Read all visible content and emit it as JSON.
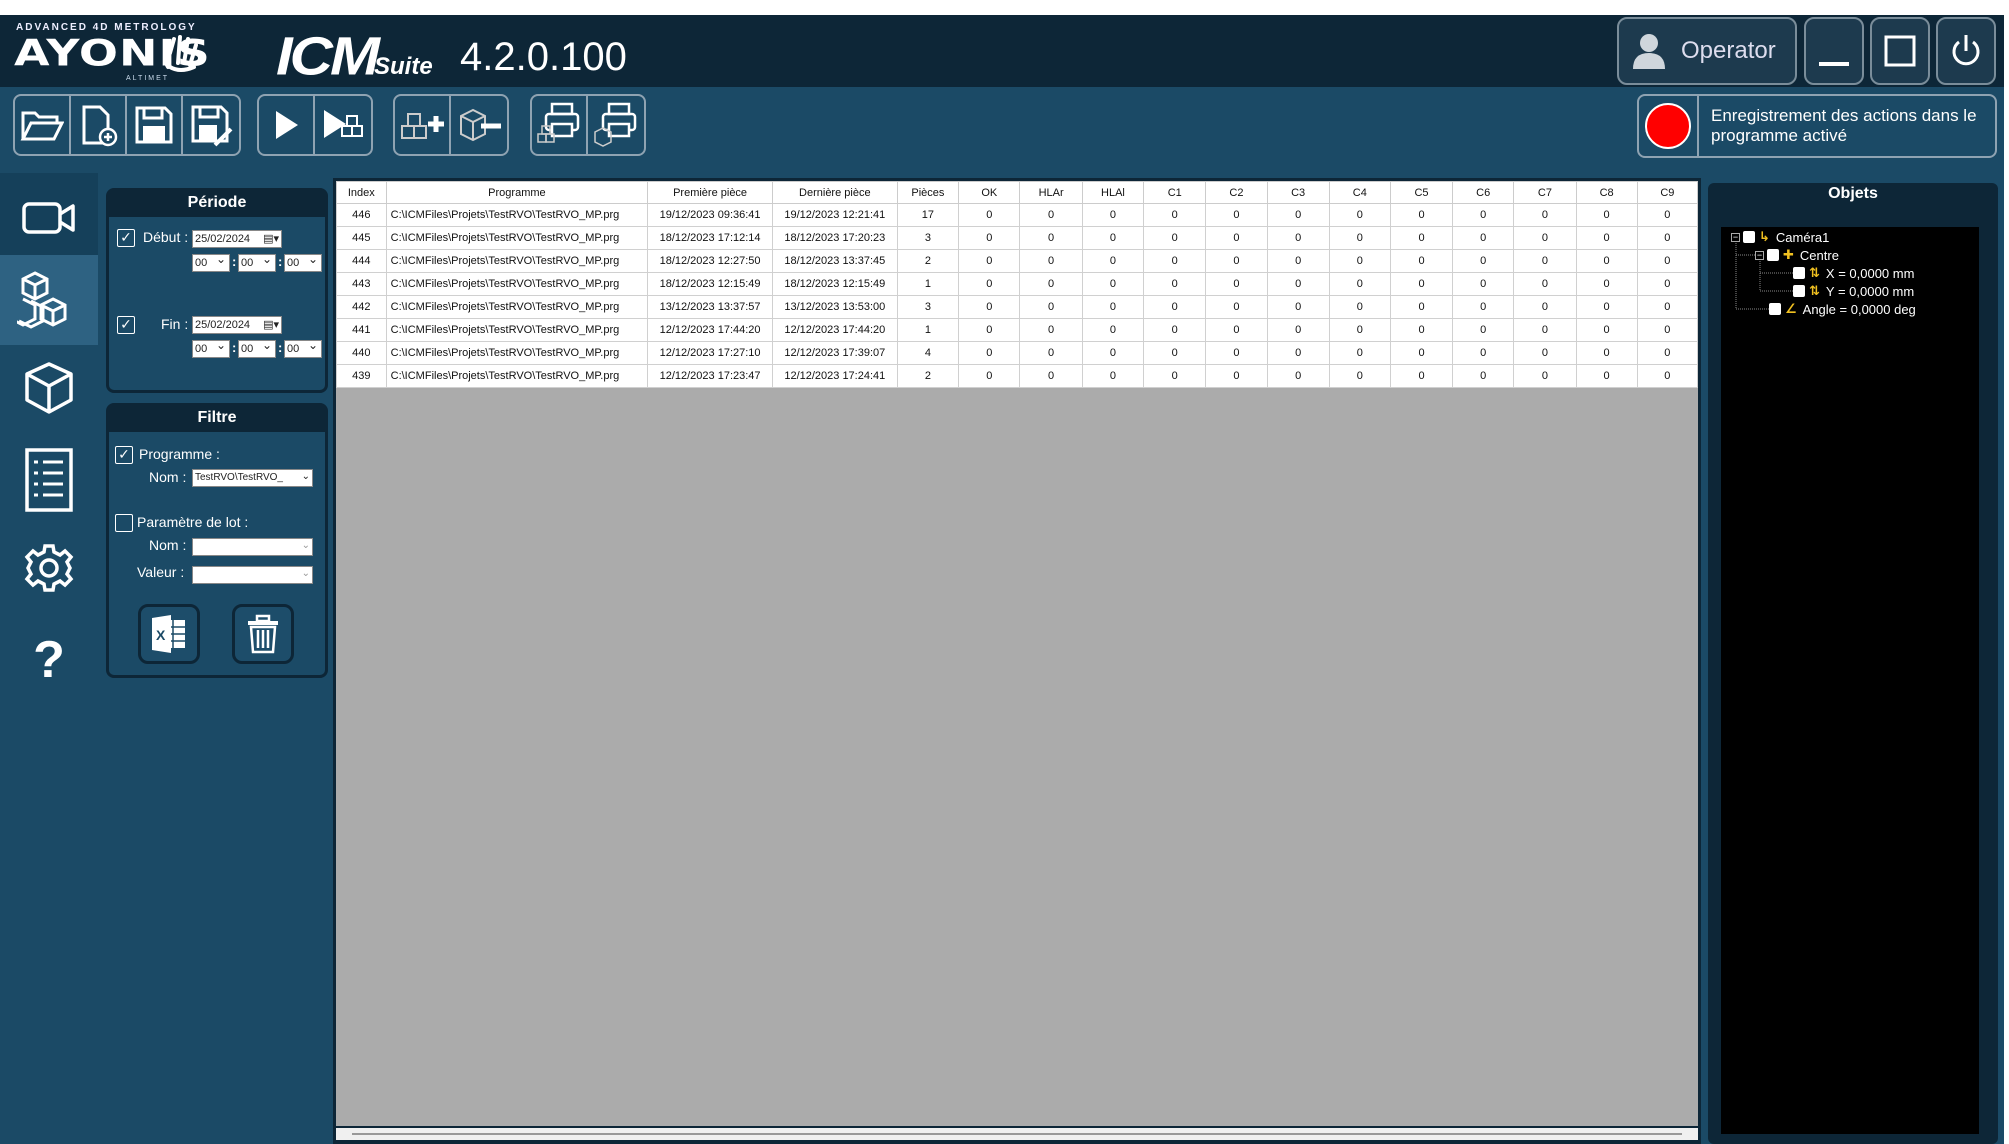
{
  "app": {
    "brand_tagline": "ADVANCED 4D METROLOGY",
    "brand_name": "AYONIS",
    "brand_sub": "ALTIMET",
    "product_name": "ICM",
    "product_suffix": "Suite",
    "version": "4.2.0.100"
  },
  "window": {
    "user_label": "Operator"
  },
  "toolbar": {
    "record_text": "Enregistrement des actions dans le programme activé",
    "record_color": "#ff0000"
  },
  "period": {
    "title": "Période",
    "start_label": "Début :",
    "start_checked": true,
    "start_date": "25/02/2024",
    "start_hh": "00",
    "start_mm": "00",
    "start_ss": "00",
    "end_label": "Fin :",
    "end_checked": true,
    "end_date": "25/02/2024",
    "end_hh": "00",
    "end_mm": "00",
    "end_ss": "00"
  },
  "filter": {
    "title": "Filtre",
    "program_label": "Programme :",
    "program_checked": true,
    "name_label": "Nom :",
    "program_name": "TestRVO\\TestRVO_",
    "lot_label": "Paramètre de lot :",
    "lot_checked": false,
    "lot_name_label": "Nom :",
    "lot_value_label": "Valeur :",
    "lot_name": "",
    "lot_value": ""
  },
  "table": {
    "columns": [
      "Index",
      "Programme",
      "Première pièce",
      "Dernière pièce",
      "Pièces",
      "OK",
      "HLAr",
      "HLAl",
      "C1",
      "C2",
      "C3",
      "C4",
      "C5",
      "C6",
      "C7",
      "C8",
      "C9"
    ],
    "rows": [
      [
        "446",
        "C:\\ICMFiles\\Projets\\TestRVO\\TestRVO_MP.prg",
        "19/12/2023 09:36:41",
        "19/12/2023 12:21:41",
        "17",
        "0",
        "0",
        "0",
        "0",
        "0",
        "0",
        "0",
        "0",
        "0",
        "0",
        "0",
        "0"
      ],
      [
        "445",
        "C:\\ICMFiles\\Projets\\TestRVO\\TestRVO_MP.prg",
        "18/12/2023 17:12:14",
        "18/12/2023 17:20:23",
        "3",
        "0",
        "0",
        "0",
        "0",
        "0",
        "0",
        "0",
        "0",
        "0",
        "0",
        "0",
        "0"
      ],
      [
        "444",
        "C:\\ICMFiles\\Projets\\TestRVO\\TestRVO_MP.prg",
        "18/12/2023 12:27:50",
        "18/12/2023 13:37:45",
        "2",
        "0",
        "0",
        "0",
        "0",
        "0",
        "0",
        "0",
        "0",
        "0",
        "0",
        "0",
        "0"
      ],
      [
        "443",
        "C:\\ICMFiles\\Projets\\TestRVO\\TestRVO_MP.prg",
        "18/12/2023 12:15:49",
        "18/12/2023 12:15:49",
        "1",
        "0",
        "0",
        "0",
        "0",
        "0",
        "0",
        "0",
        "0",
        "0",
        "0",
        "0",
        "0"
      ],
      [
        "442",
        "C:\\ICMFiles\\Projets\\TestRVO\\TestRVO_MP.prg",
        "13/12/2023 13:37:57",
        "13/12/2023 13:53:00",
        "3",
        "0",
        "0",
        "0",
        "0",
        "0",
        "0",
        "0",
        "0",
        "0",
        "0",
        "0",
        "0"
      ],
      [
        "441",
        "C:\\ICMFiles\\Projets\\TestRVO\\TestRVO_MP.prg",
        "12/12/2023 17:44:20",
        "12/12/2023 17:44:20",
        "1",
        "0",
        "0",
        "0",
        "0",
        "0",
        "0",
        "0",
        "0",
        "0",
        "0",
        "0",
        "0"
      ],
      [
        "440",
        "C:\\ICMFiles\\Projets\\TestRVO\\TestRVO_MP.prg",
        "12/12/2023 17:27:10",
        "12/12/2023 17:39:07",
        "4",
        "0",
        "0",
        "0",
        "0",
        "0",
        "0",
        "0",
        "0",
        "0",
        "0",
        "0",
        "0"
      ],
      [
        "439",
        "C:\\ICMFiles\\Projets\\TestRVO\\TestRVO_MP.prg",
        "12/12/2023 17:23:47",
        "12/12/2023 17:24:41",
        "2",
        "0",
        "0",
        "0",
        "0",
        "0",
        "0",
        "0",
        "0",
        "0",
        "0",
        "0",
        "0"
      ]
    ]
  },
  "objects": {
    "title": "Objets",
    "tree": [
      {
        "label": "Caméra1",
        "icon": "axes-icon"
      },
      {
        "label": "Centre",
        "icon": "cross-icon"
      },
      {
        "label": "X = 0,0000 mm",
        "icon": "axes-icon"
      },
      {
        "label": "Y = 0,0000 mm",
        "icon": "axes-icon"
      },
      {
        "label": "Angle = 0,0000 deg",
        "icon": "angle-icon"
      }
    ]
  }
}
